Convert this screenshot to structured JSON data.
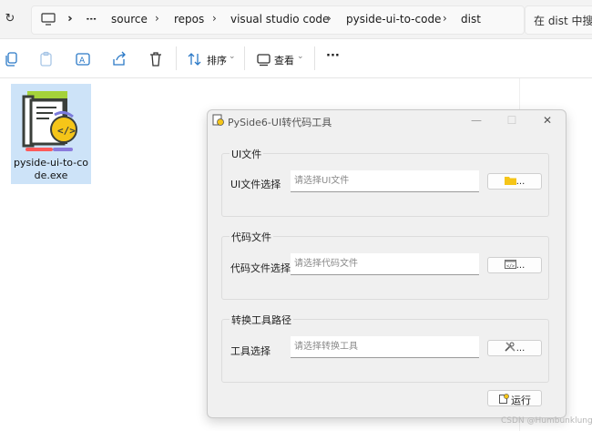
{
  "explorer": {
    "breadcrumbs": [
      "source",
      "repos",
      "visual studio code",
      "pyside-ui-to-code",
      "dist"
    ],
    "ellipsis": "···",
    "search_placeholder": "在 dist 中搜索",
    "toolbar": {
      "sort_label": "排序",
      "view_label": "查看",
      "more_label": "···"
    },
    "file": {
      "name_line1": "pyside-ui-to-co",
      "name_line2": "de.exe"
    }
  },
  "dialog": {
    "title": "PySide6-UI转代码工具",
    "minimize": "—",
    "maximize": "☐",
    "close": "✕",
    "groups": [
      {
        "title": "UI文件",
        "field_label": "UI文件选择",
        "placeholder": "请选择UI文件",
        "button": "..."
      },
      {
        "title": "代码文件",
        "field_label": "代码文件选择",
        "placeholder": "请选择代码文件",
        "button": "..."
      },
      {
        "title": "转换工具路径",
        "field_label": "工具选择",
        "placeholder": "请选择转换工具",
        "button": "..."
      }
    ],
    "run_label": "运行"
  },
  "watermark": "CSDN @Humbunklung",
  "colors": {
    "selection": "#cde3f8",
    "dialog_bg": "#f0f0f0",
    "folder": "#f5c518"
  }
}
